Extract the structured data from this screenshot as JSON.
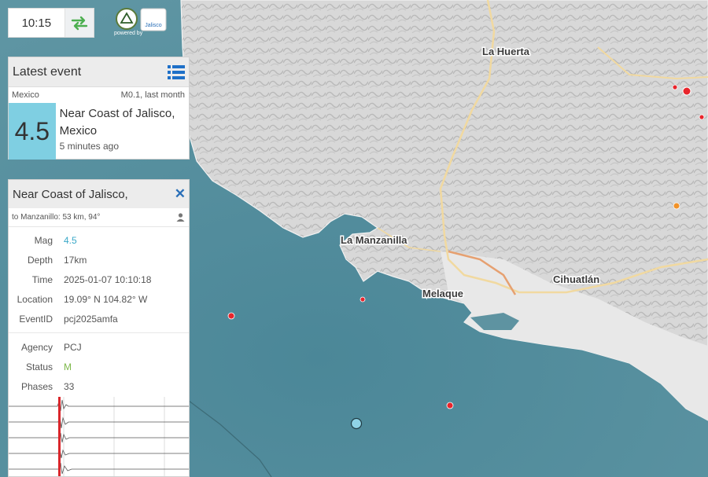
{
  "clock": {
    "time": "10:15"
  },
  "logos": {
    "org": "Jalisco",
    "powered": "powered by"
  },
  "latest": {
    "title": "Latest event",
    "region": "Mexico",
    "summary": "M0.1, last month",
    "magnitude": "4.5",
    "place": "Near Coast of Jalisco, Mexico",
    "ago": "5 minutes ago"
  },
  "detail": {
    "title": "Near Coast of Jalisco,",
    "distance": "to Manzanillo: 53 km, 94°",
    "rows1": [
      {
        "label": "Mag",
        "value": "4.5"
      },
      {
        "label": "Depth",
        "value": "17km"
      },
      {
        "label": "Time",
        "value": "2025-01-07 10:10:18"
      },
      {
        "label": "Location",
        "value": "19.09° N 104.82° W"
      },
      {
        "label": "EventID",
        "value": "pcj2025amfa"
      }
    ],
    "rows2": [
      {
        "label": "Agency",
        "value": "PCJ"
      },
      {
        "label": "Status",
        "value": "M"
      },
      {
        "label": "Phases",
        "value": "33"
      }
    ]
  },
  "map_labels": {
    "la_huerta": "La Huerta",
    "la_manzanilla": "La Manzanilla",
    "melaque": "Melaque",
    "cihuatlan": "Cihuatlán"
  },
  "colors": {
    "ocean": "#4f8a9a",
    "land": "#d9d9d9",
    "magnitude_box": "#7fcfe2",
    "event_dot": "#e8252c",
    "selected_event": "#8fd3e6",
    "mag_value": "#3aa8c8",
    "status_value": "#7db84a"
  },
  "icons": {
    "swap": "swap-arrows-icon",
    "list": "list-icon",
    "close": "close-icon",
    "person": "person-icon"
  }
}
